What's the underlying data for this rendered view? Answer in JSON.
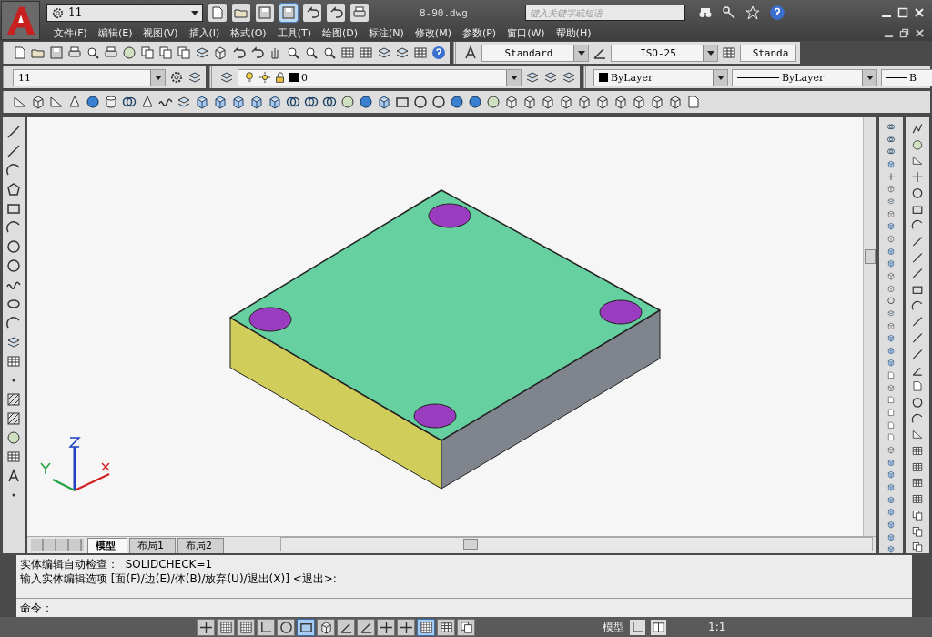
{
  "window": {
    "title": "8-90.dwg"
  },
  "workspace": {
    "value": "11"
  },
  "search": {
    "placeholder": "键入关键字或短语"
  },
  "menu": [
    "文件(F)",
    "编辑(E)",
    "视图(V)",
    "插入(I)",
    "格式(O)",
    "工具(T)",
    "绘图(D)",
    "标注(N)",
    "修改(M)",
    "参数(P)",
    "窗口(W)",
    "帮助(H)"
  ],
  "styles_toolbar": {
    "text_style": "Standard",
    "dim_style": "ISO-25",
    "table_style": "Standa"
  },
  "layers_toolbar": {
    "layer_state": "11",
    "layer": "0",
    "color_setting": "ByLayer",
    "linetype": "ByLayer",
    "lineweight": "B"
  },
  "layout_tabs": [
    {
      "label": "模型",
      "selected": true
    },
    {
      "label": "布局1",
      "selected": false
    },
    {
      "label": "布局2",
      "selected": false
    }
  ],
  "command_history": [
    "实体编辑自动检查：  SOLIDCHECK=1",
    "输入实体编辑选项 [面(F)/边(E)/体(B)/放弃(U)/退出(X)] <退出>:"
  ],
  "command_prompt": "命令：",
  "status_toggles": [
    {
      "on": false
    },
    {
      "on": false
    },
    {
      "on": false
    },
    {
      "on": false
    },
    {
      "on": false
    },
    {
      "on": true
    },
    {
      "on": false
    },
    {
      "on": false
    },
    {
      "on": false
    },
    {
      "on": false
    },
    {
      "on": false
    },
    {
      "on": true
    },
    {
      "on": false
    },
    {
      "on": false
    }
  ],
  "status_bar": {
    "space": "模型",
    "annotation_scale": "1:1"
  }
}
